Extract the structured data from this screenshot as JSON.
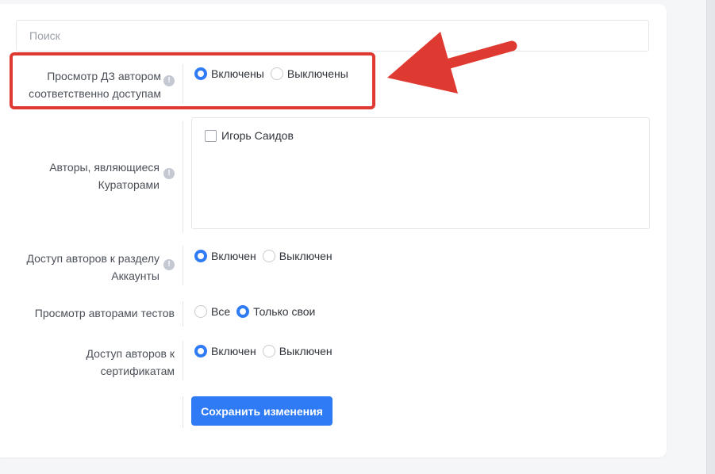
{
  "search": {
    "placeholder": "Поиск"
  },
  "settings": [
    {
      "label": "Просмотр ДЗ автором соответственно доступам",
      "options": [
        "Включены",
        "Выключены"
      ],
      "selected": 0
    },
    {
      "label": "Авторы, являющиеся Кураторами",
      "authors": [
        {
          "name": "Игорь Саидов",
          "checked": false
        }
      ]
    },
    {
      "label": "Доступ авторов к разделу Аккаунты",
      "options": [
        "Включен",
        "Выключен"
      ],
      "selected": 0
    },
    {
      "label": "Просмотр авторами тестов",
      "options": [
        "Все",
        "Только свои"
      ],
      "selected": 1
    },
    {
      "label": "Доступ авторов к сертификатам",
      "options": [
        "Включен",
        "Выключен"
      ],
      "selected": 0
    }
  ],
  "actions": {
    "save_label": "Сохранить изменения"
  },
  "colors": {
    "accent": "#2f7bf5",
    "highlight": "#df3a32"
  }
}
